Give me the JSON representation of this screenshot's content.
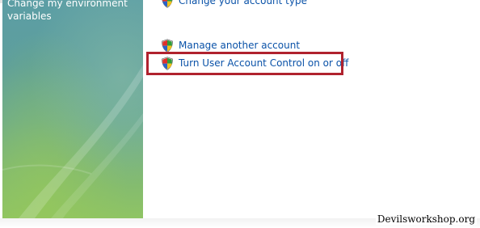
{
  "sidebar": {
    "link_text": "Change my environment\nvariables"
  },
  "tasks": [
    {
      "label": "Change your account type",
      "icon": "uac-shield-icon"
    },
    {
      "label": "Manage another account",
      "icon": "uac-shield-icon"
    },
    {
      "label": "Turn User Account Control on or off",
      "icon": "uac-shield-icon"
    }
  ],
  "highlight": {
    "color": "#b0222e",
    "target": "Turn User Account Control on or off"
  },
  "watermark": "Devilsworkshop.org",
  "colors": {
    "link": "#0a52a8",
    "sidebar_top": "#5c9ea5",
    "sidebar_bottom": "#8fc464"
  }
}
